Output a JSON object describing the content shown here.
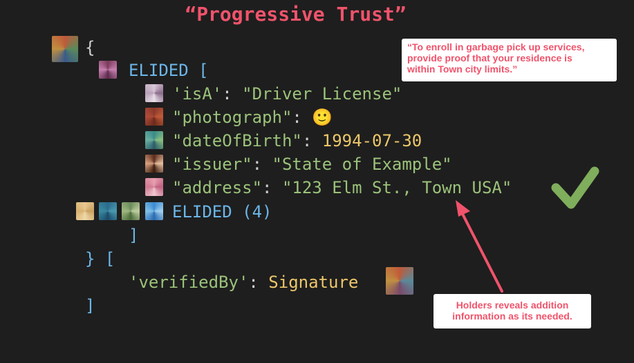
{
  "slide": {
    "title": "“Progressive Trust”",
    "lines": {
      "open_brace": "{",
      "elided_open_kw": "ELIDED",
      "elided_open_bracket": " [",
      "isa_key": "'isA'",
      "isa_colon": ": ",
      "isa_value": "\"Driver License\"",
      "photo_key": "\"photograph\"",
      "photo_colon": ": ",
      "photo_value": "🙂",
      "dob_key": "\"dateOfBirth\"",
      "dob_colon": ": ",
      "dob_value": "1994-07-30",
      "issuer_key": "\"issuer\"",
      "issuer_colon": ": ",
      "issuer_value": "\"State of Example\"",
      "address_key": "\"address\"",
      "address_colon": ": ",
      "address_value": "\"123 Elm St., Town USA\"",
      "elided_count": "ELIDED (4)",
      "close_bracket_inner": "]",
      "close_brace_bracket": "} [",
      "verified_key": "'verifiedBy'",
      "verified_colon": ": ",
      "verified_value": "Signature",
      "close_bracket_outer": "]"
    },
    "callout_top": [
      "“To enroll in garbage pick up services,",
      "provide proof that your residence is",
      "within Town city limits.”"
    ],
    "callout_bottom": [
      "Holders reveals addition",
      "information as its needed."
    ],
    "icons": {
      "checkmark": "checkmark-icon",
      "arrow": "arrow-icon",
      "digest_squares": "digest-pattern-icon"
    },
    "colors": {
      "background": "#1e1e1e",
      "title": "#f0536b",
      "keyword": "#6cb6e8",
      "string": "#9bc27a",
      "number": "#ecc66a",
      "check": "#7fae5c",
      "arrow": "#f0536b"
    }
  }
}
